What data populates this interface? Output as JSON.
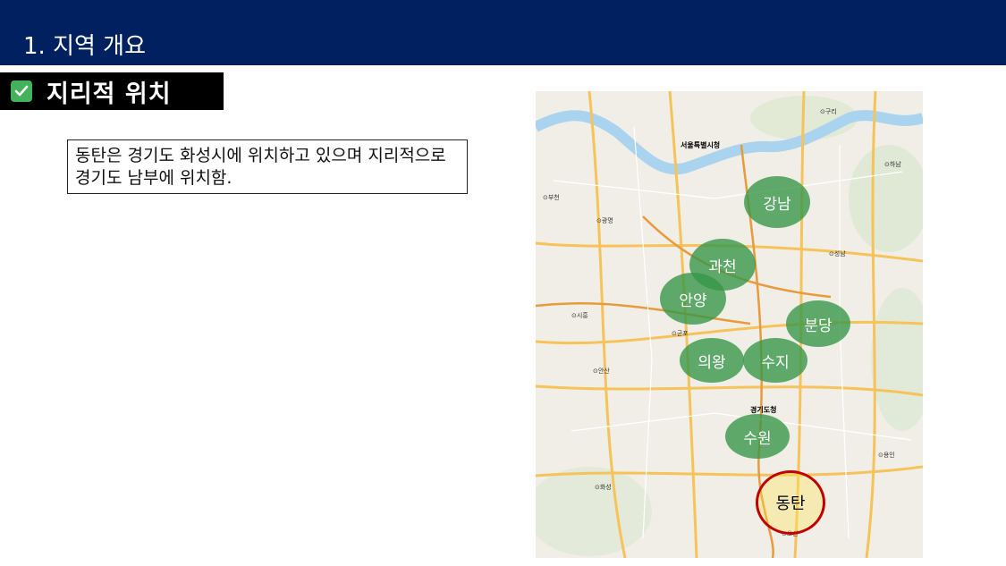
{
  "header": {
    "title": "1. 지역 개요"
  },
  "section": {
    "icon": "check-mark-icon",
    "title": "지리적 위치"
  },
  "description": {
    "text": "동탄은 경기도 화성시에 위치하고 있으며 지리적으로 경기도 남부에 위치함."
  },
  "map": {
    "regions": [
      "강남",
      "과천",
      "안양",
      "분당",
      "의왕",
      "수지",
      "수원"
    ],
    "target": "동탄",
    "labels": {
      "seoul": "서울특별시청",
      "gyeonggi": "경기도청",
      "guri": "⊙구리",
      "hanam": "⊙하남",
      "seongnam": "⊙성남",
      "gwangmyeong": "⊙광명",
      "siheung": "⊙시흥",
      "gunpo": "⊙군포",
      "ansan": "⊙안산",
      "hwaseong": "⊙화성",
      "yongin": "⊙용인",
      "osan": "⊙오산",
      "bucheon": "⊙부천"
    },
    "colors": {
      "region": "#349646",
      "target_ring": "#c00000",
      "header": "#002060"
    }
  }
}
